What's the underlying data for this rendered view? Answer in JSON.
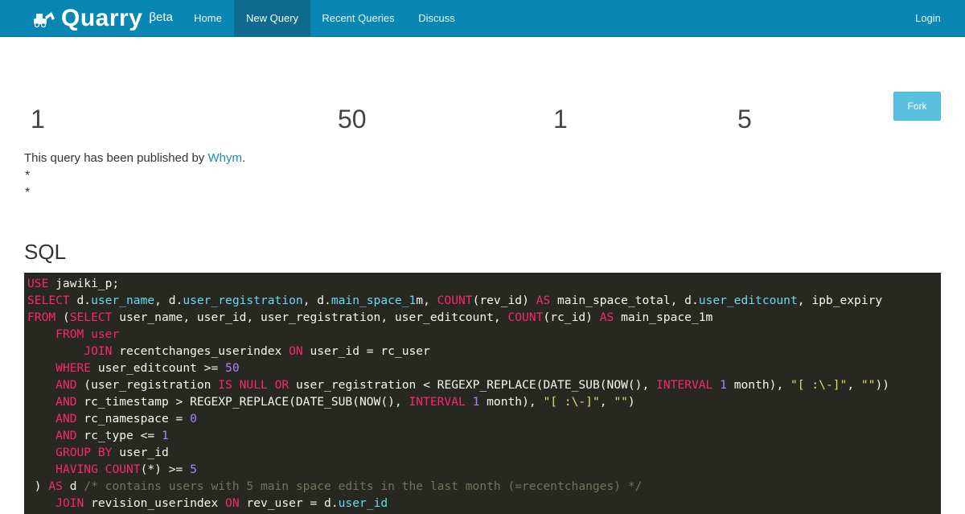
{
  "navbar": {
    "brand_name": "Quarry",
    "brand_beta": "βeta",
    "items": [
      {
        "label": "Home"
      },
      {
        "label": "New Query"
      },
      {
        "label": "Recent Queries"
      },
      {
        "label": "Discuss"
      }
    ],
    "login_label": "Login",
    "active_item": "New Query"
  },
  "counts": [
    "1",
    "50",
    "1",
    "5"
  ],
  "fork_label": "Fork",
  "published": {
    "prefix": "This query has been published by ",
    "author": "Whym",
    "suffix": "."
  },
  "stars": [
    "*",
    "*"
  ],
  "sql_heading": "SQL",
  "code_lines": [
    [
      [
        "kw",
        "USE"
      ],
      [
        "t",
        " jawiki_p;"
      ]
    ],
    [
      [
        "kw",
        "SELECT"
      ],
      [
        "t",
        " d."
      ],
      [
        "attr",
        "user_name"
      ],
      [
        "t",
        ", d."
      ],
      [
        "attr",
        "user_registration"
      ],
      [
        "t",
        ", d."
      ],
      [
        "attr",
        "main_space_1"
      ],
      [
        "t",
        "m, "
      ],
      [
        "fn",
        "COUNT"
      ],
      [
        "t",
        "(rev_id) "
      ],
      [
        "kw",
        "AS"
      ],
      [
        "t",
        " main_space_total, d."
      ],
      [
        "attr",
        "user_editcount"
      ],
      [
        "t",
        ", ipb_expiry"
      ]
    ],
    [
      [
        "kw",
        "FROM"
      ],
      [
        "t",
        " ("
      ],
      [
        "kw",
        "SELECT"
      ],
      [
        "t",
        " user_name, user_id, user_registration, user_editcount, "
      ],
      [
        "fn",
        "COUNT"
      ],
      [
        "t",
        "(rc_id) "
      ],
      [
        "kw",
        "AS"
      ],
      [
        "t",
        " main_space_1m"
      ]
    ],
    [
      [
        "t",
        "    "
      ],
      [
        "kw",
        "FROM"
      ],
      [
        "t",
        " "
      ],
      [
        "kw",
        "user"
      ]
    ],
    [
      [
        "t",
        "        "
      ],
      [
        "kw",
        "JOIN"
      ],
      [
        "t",
        " recentchanges_userindex "
      ],
      [
        "kw",
        "ON"
      ],
      [
        "t",
        " user_id = rc_user"
      ]
    ],
    [
      [
        "t",
        "    "
      ],
      [
        "kw",
        "WHERE"
      ],
      [
        "t",
        " user_editcount >= "
      ],
      [
        "num",
        "50"
      ]
    ],
    [
      [
        "t",
        "    "
      ],
      [
        "kw",
        "AND"
      ],
      [
        "t",
        " (user_registration "
      ],
      [
        "kw",
        "IS"
      ],
      [
        "t",
        " "
      ],
      [
        "kw",
        "NULL"
      ],
      [
        "t",
        " "
      ],
      [
        "kw",
        "OR"
      ],
      [
        "t",
        " user_registration < REGEXP_REPLACE(DATE_SUB(NOW(), "
      ],
      [
        "kw",
        "INTERVAL"
      ],
      [
        "t",
        " "
      ],
      [
        "num",
        "1"
      ],
      [
        "t",
        " month), "
      ],
      [
        "str",
        "\"[ :\\-]\""
      ],
      [
        "t",
        ", "
      ],
      [
        "str",
        "\"\""
      ],
      [
        "t",
        "))"
      ]
    ],
    [
      [
        "t",
        "    "
      ],
      [
        "kw",
        "AND"
      ],
      [
        "t",
        " rc_timestamp > REGEXP_REPLACE(DATE_SUB(NOW(), "
      ],
      [
        "kw",
        "INTERVAL"
      ],
      [
        "t",
        " "
      ],
      [
        "num",
        "1"
      ],
      [
        "t",
        " month), "
      ],
      [
        "str",
        "\"[ :\\-]\""
      ],
      [
        "t",
        ", "
      ],
      [
        "str",
        "\"\""
      ],
      [
        "t",
        ")"
      ]
    ],
    [
      [
        "t",
        "    "
      ],
      [
        "kw",
        "AND"
      ],
      [
        "t",
        " rc_namespace = "
      ],
      [
        "num",
        "0"
      ]
    ],
    [
      [
        "t",
        "    "
      ],
      [
        "kw",
        "AND"
      ],
      [
        "t",
        " rc_type <= "
      ],
      [
        "num",
        "1"
      ]
    ],
    [
      [
        "t",
        "    "
      ],
      [
        "kw",
        "GROUP BY"
      ],
      [
        "t",
        " user_id"
      ]
    ],
    [
      [
        "t",
        "    "
      ],
      [
        "kw",
        "HAVING"
      ],
      [
        "t",
        " "
      ],
      [
        "fn",
        "COUNT"
      ],
      [
        "t",
        "(*) >= "
      ],
      [
        "num",
        "5"
      ]
    ],
    [
      [
        "t",
        " ) "
      ],
      [
        "kw",
        "AS"
      ],
      [
        "t",
        " d "
      ],
      [
        "cm",
        "/* contains users with 5 main space edits in the last month (=recentchanges) */"
      ]
    ],
    [
      [
        "t",
        "    "
      ],
      [
        "kw",
        "JOIN"
      ],
      [
        "t",
        " revision_userindex "
      ],
      [
        "kw",
        "ON"
      ],
      [
        "t",
        " rev_user = d."
      ],
      [
        "attr",
        "user_id"
      ]
    ]
  ],
  "colors": {
    "navbar_bg": "#0a86b4",
    "navbar_active": "#0f6b8d",
    "fork_bg": "#5bc0de",
    "link": "#1a8bb3",
    "code_bg": "#272822",
    "keyword": "#f92672",
    "attribute": "#66d9ef",
    "number": "#ae81ff",
    "string": "#e6db74",
    "comment": "#75715e"
  }
}
